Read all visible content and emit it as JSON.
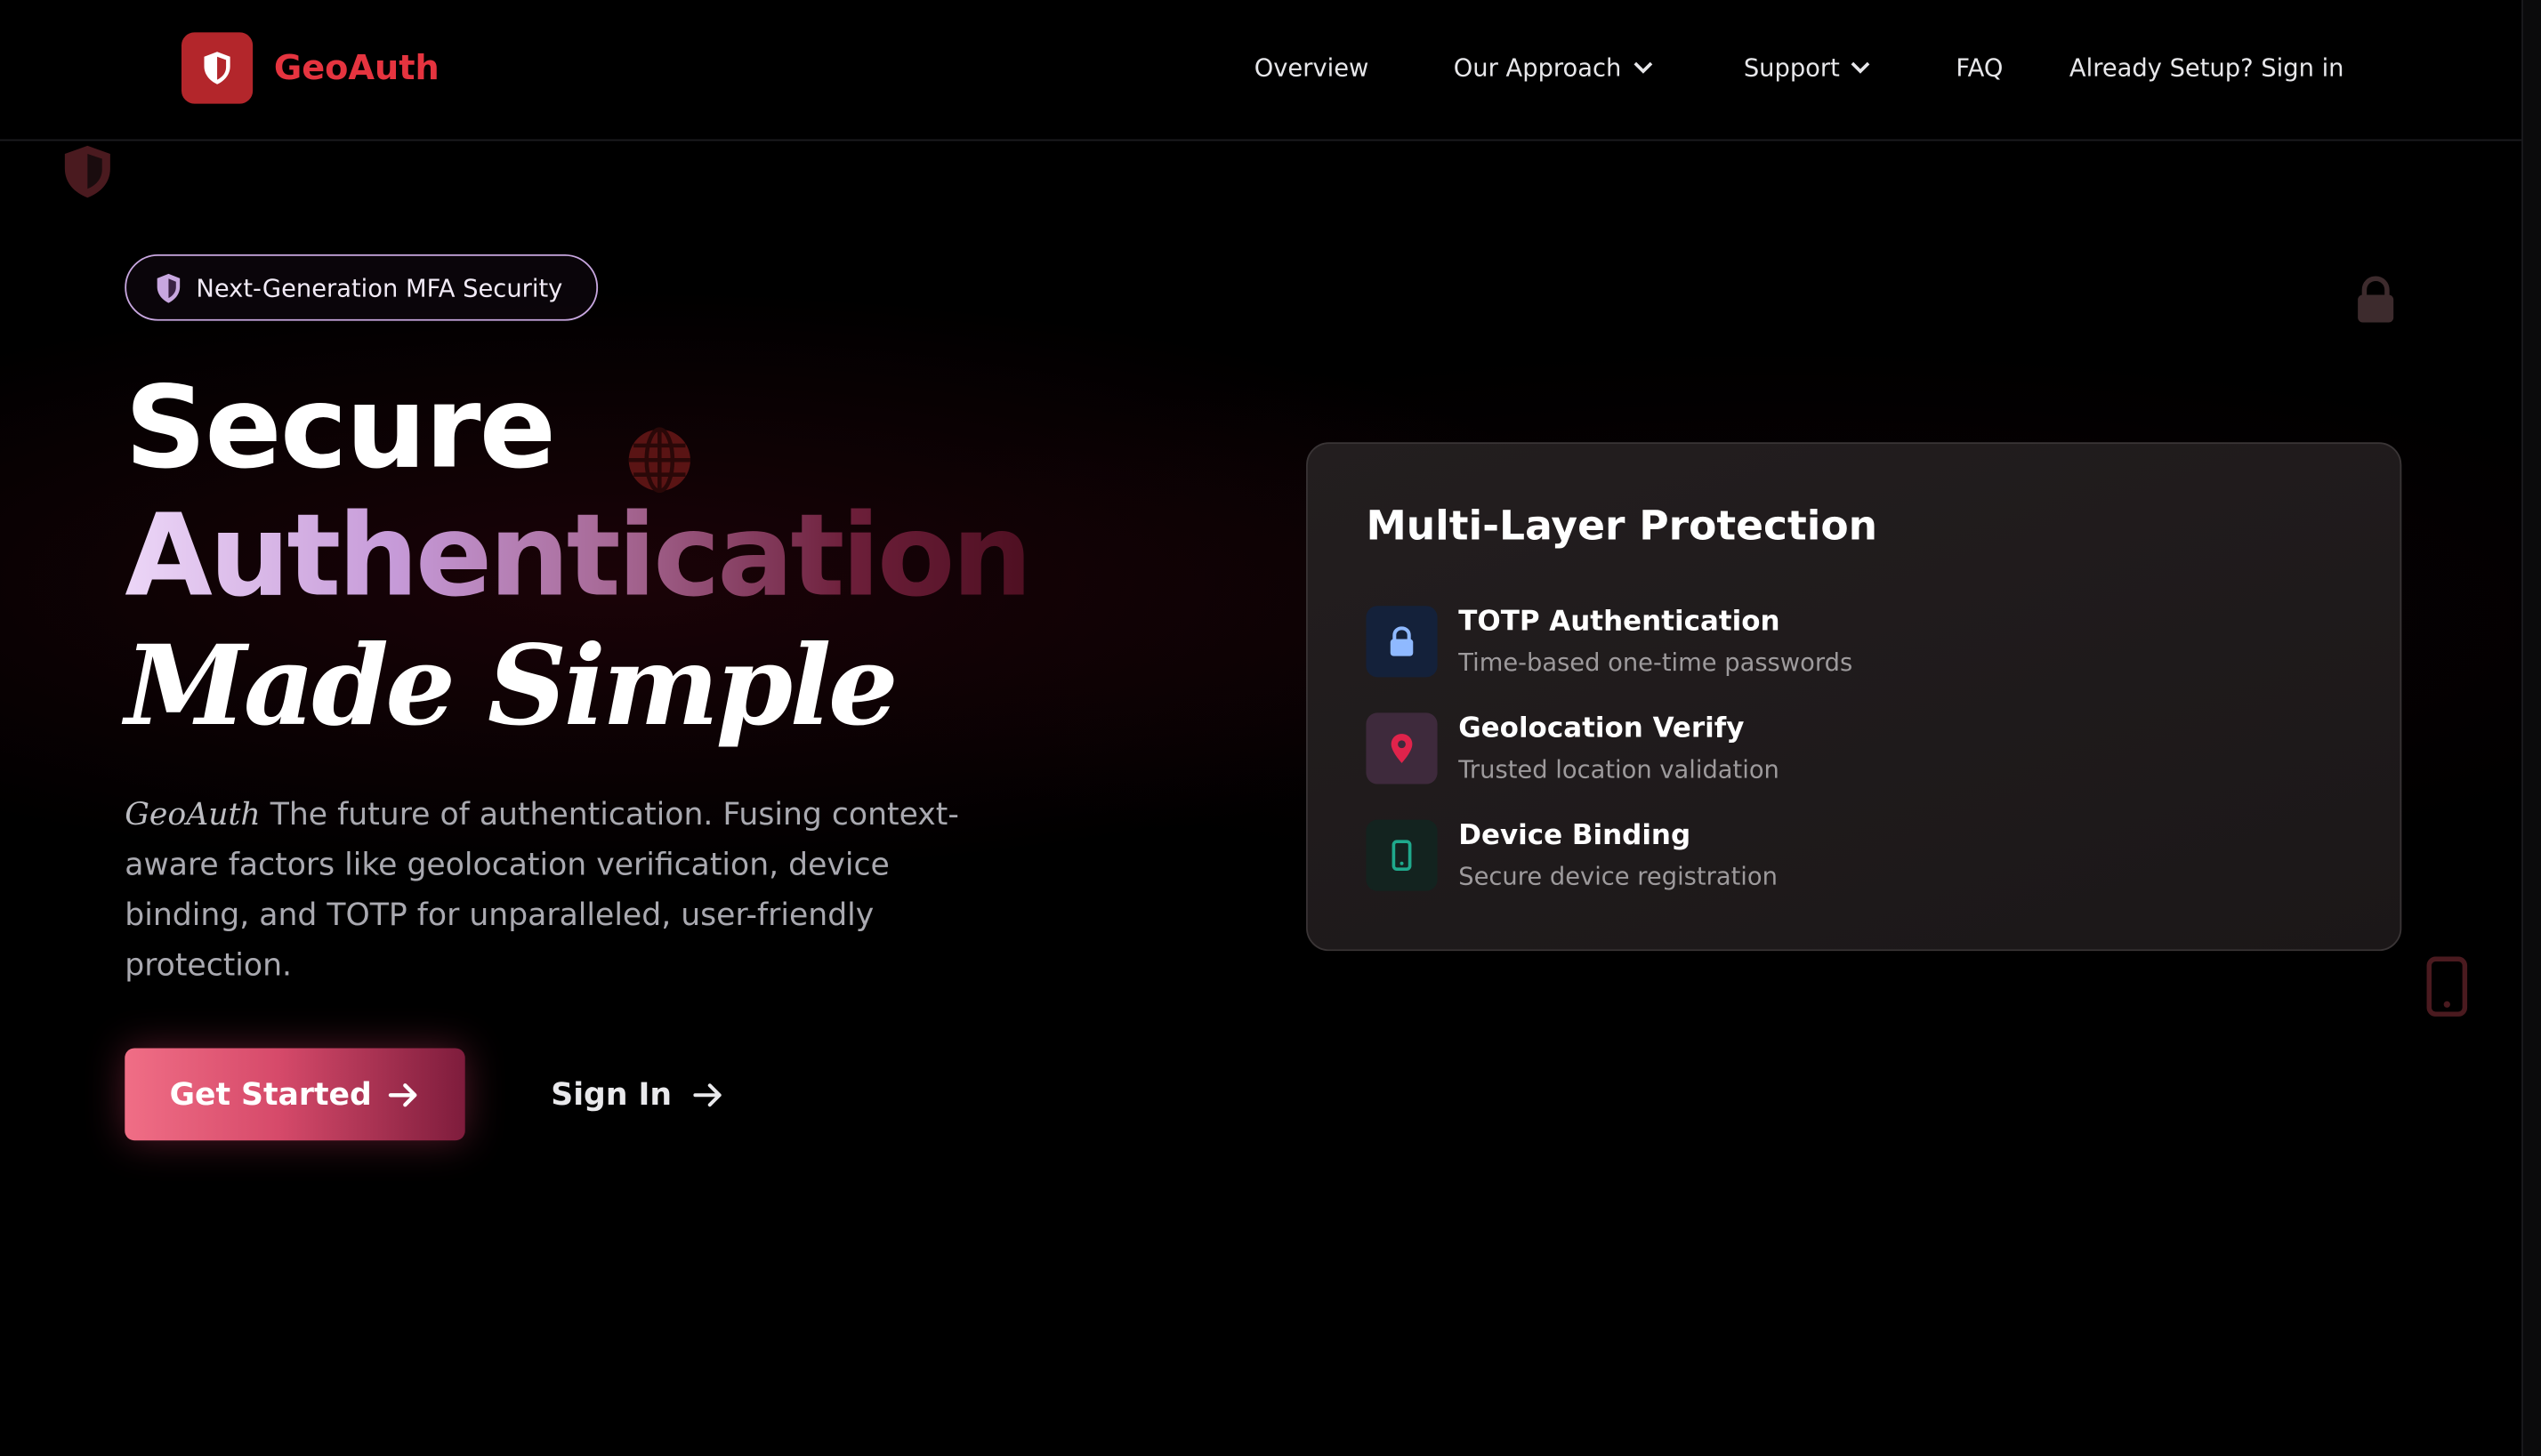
{
  "brand": {
    "name": "GeoAuth",
    "logo_icon": "shield-icon",
    "color": "#e5343f"
  },
  "nav": {
    "items": [
      {
        "label": "Overview"
      },
      {
        "label": "Our Approach",
        "has_dropdown": true
      },
      {
        "label": "Support",
        "has_dropdown": true
      },
      {
        "label": "FAQ"
      },
      {
        "label": "Already Setup? Sign in"
      }
    ]
  },
  "hero": {
    "badge": "Next-Generation MFA Security",
    "headline": {
      "line1": "Secure",
      "line2": "Authentication",
      "line3": "Made Simple"
    },
    "description_brand": "GeoAuth",
    "description": "The future of authentication. Fusing context-aware factors like geolocation verification, device binding, and TOTP for unparalleled, user-friendly protection.",
    "primary_button": "Get Started",
    "secondary_button": "Sign In"
  },
  "card": {
    "title": "Multi-Layer Protection",
    "features": [
      {
        "title": "TOTP Authentication",
        "subtitle": "Time-based one-time passwords",
        "icon": "lock-icon",
        "accent": "#7fb0ff"
      },
      {
        "title": "Geolocation Verify",
        "subtitle": "Trusted location validation",
        "icon": "location-pin-icon",
        "accent": "#e0234b"
      },
      {
        "title": "Device Binding",
        "subtitle": "Secure device registration",
        "icon": "phone-icon",
        "accent": "#1fa98c"
      }
    ]
  }
}
